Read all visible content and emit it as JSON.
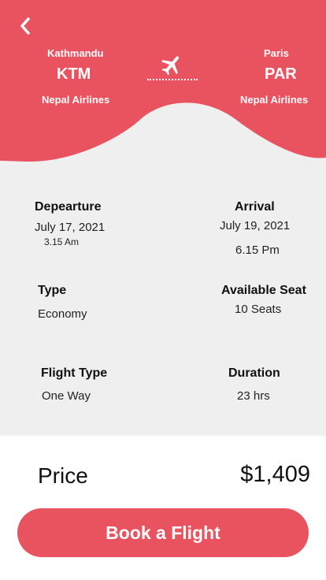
{
  "header": {
    "origin": {
      "city": "Kathmandu",
      "code": "KTM",
      "airline": "Nepal Airlines"
    },
    "destination": {
      "city": "Paris",
      "code": "PAR",
      "airline": "Nepal Airlines"
    }
  },
  "details": {
    "departure_label": "Depearture",
    "departure_date": "July 17, 2021",
    "departure_time": "3.15 Am",
    "arrival_label": "Arrival",
    "arrival_date": "July 19, 2021",
    "arrival_time": "6.15 Pm",
    "type_label": "Type",
    "type_value": "Economy",
    "seat_label": "Available Seat",
    "seat_value": "10 Seats",
    "flight_type_label": "Flight Type",
    "flight_type_value": "One Way",
    "duration_label": "Duration",
    "duration_value": "23 hrs"
  },
  "price": {
    "label": "Price",
    "value": "$1,409"
  },
  "actions": {
    "book_label": "Book a Flight"
  },
  "colors": {
    "accent": "#e9535f",
    "background": "#efefef"
  },
  "icons": {
    "back": "chevron-left-icon",
    "plane": "airplane-icon"
  }
}
